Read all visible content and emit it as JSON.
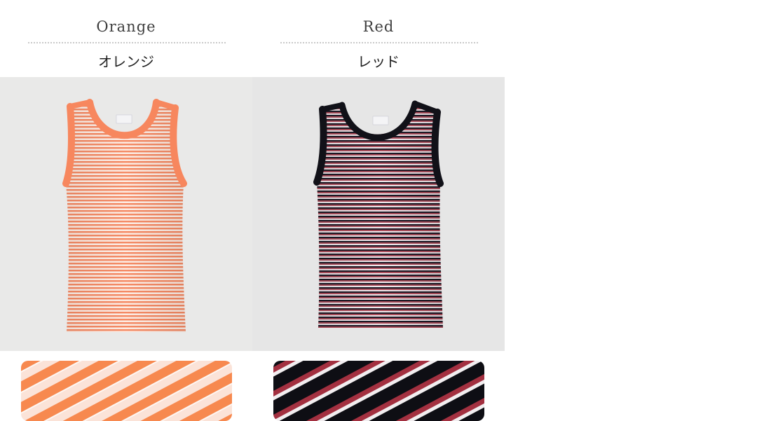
{
  "variants": [
    {
      "name_en": "Orange",
      "name_jp": "オレンジ",
      "colors": {
        "stripe": "#f7825a",
        "trim": "#f7875e",
        "base": "#fbe7dc",
        "background": "#e9e9e8"
      }
    },
    {
      "name_en": "Red",
      "name_jp": "レッド",
      "colors": {
        "stripe_dark": "#1a1a24",
        "stripe_red": "#a33040",
        "stripe_white": "#f2eef0",
        "trim": "#111118",
        "background": "#e6e6e6"
      }
    }
  ]
}
